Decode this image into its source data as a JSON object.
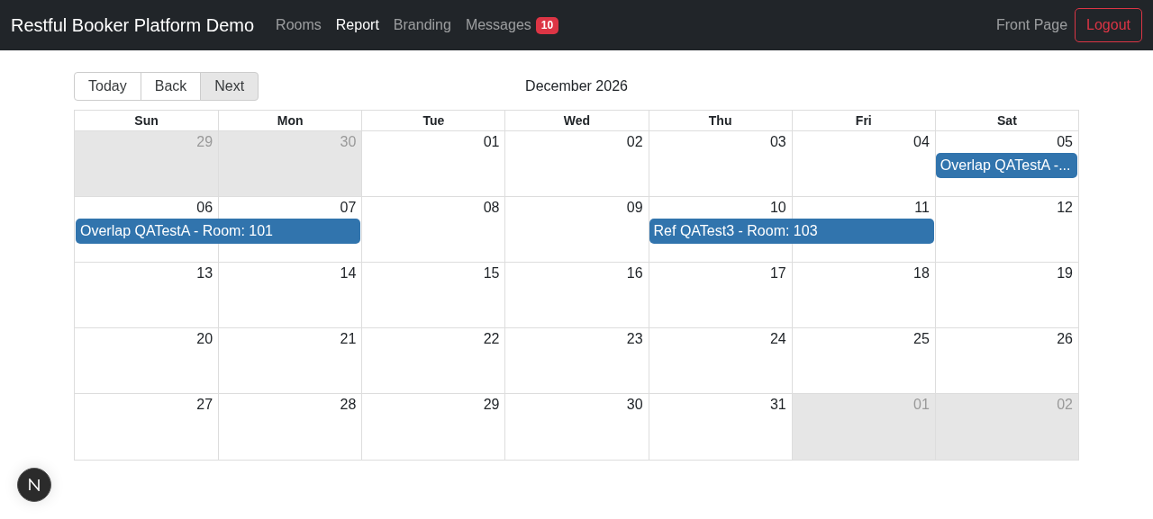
{
  "navbar": {
    "brand": "Restful Booker Platform Demo",
    "links": [
      {
        "label": "Rooms",
        "selected": false
      },
      {
        "label": "Report",
        "selected": true
      },
      {
        "label": "Branding",
        "selected": false
      },
      {
        "label": "Messages",
        "selected": false,
        "badge": "10"
      }
    ],
    "right_link": "Front Page",
    "logout": "Logout"
  },
  "toolbar": {
    "buttons": [
      {
        "label": "Today",
        "selected": false
      },
      {
        "label": "Back",
        "selected": false
      },
      {
        "label": "Next",
        "selected": true
      }
    ],
    "title": "December 2026"
  },
  "calendar": {
    "weekdays": [
      "Sun",
      "Mon",
      "Tue",
      "Wed",
      "Thu",
      "Fri",
      "Sat"
    ],
    "weeks": [
      [
        {
          "date": "29",
          "off_range": true
        },
        {
          "date": "30",
          "off_range": true
        },
        {
          "date": "01",
          "off_range": false
        },
        {
          "date": "02",
          "off_range": false
        },
        {
          "date": "03",
          "off_range": false
        },
        {
          "date": "04",
          "off_range": false
        },
        {
          "date": "05",
          "off_range": false,
          "event": {
            "title": "Overlap QATestA -..."
          }
        }
      ],
      [
        {
          "date": "06",
          "off_range": false,
          "event": {
            "title": "Overlap QATestA - Room: 101"
          }
        },
        {
          "date": "07",
          "off_range": false,
          "continues": true
        },
        {
          "date": "08",
          "off_range": false
        },
        {
          "date": "09",
          "off_range": false
        },
        {
          "date": "10",
          "off_range": false,
          "event": {
            "title": "Ref QATest3 - Room: 103"
          }
        },
        {
          "date": "11",
          "off_range": false,
          "continues": true
        },
        {
          "date": "12",
          "off_range": false
        }
      ],
      [
        {
          "date": "13",
          "off_range": false
        },
        {
          "date": "14",
          "off_range": false
        },
        {
          "date": "15",
          "off_range": false
        },
        {
          "date": "16",
          "off_range": false
        },
        {
          "date": "17",
          "off_range": false
        },
        {
          "date": "18",
          "off_range": false
        },
        {
          "date": "19",
          "off_range": false
        }
      ],
      [
        {
          "date": "20",
          "off_range": false
        },
        {
          "date": "21",
          "off_range": false
        },
        {
          "date": "22",
          "off_range": false
        },
        {
          "date": "23",
          "off_range": false
        },
        {
          "date": "24",
          "off_range": false
        },
        {
          "date": "25",
          "off_range": false
        },
        {
          "date": "26",
          "off_range": false
        }
      ],
      [
        {
          "date": "27",
          "off_range": false
        },
        {
          "date": "28",
          "off_range": false
        },
        {
          "date": "29",
          "off_range": false
        },
        {
          "date": "30",
          "off_range": false
        },
        {
          "date": "31",
          "off_range": false
        },
        {
          "date": "01",
          "off_range": true
        },
        {
          "date": "02",
          "off_range": true
        }
      ]
    ]
  }
}
